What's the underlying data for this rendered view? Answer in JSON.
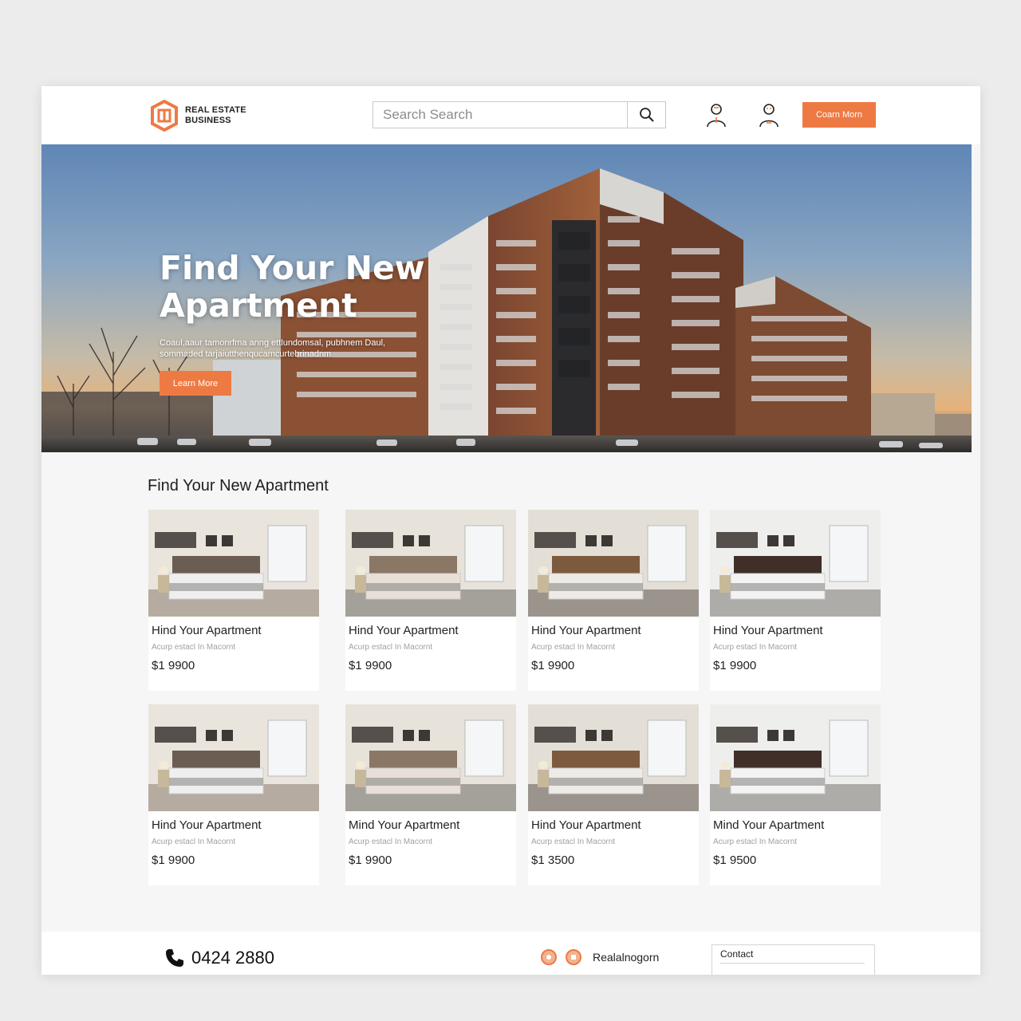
{
  "brand": {
    "line1": "REAL ESTATE",
    "line2": "BUSINESS",
    "accent": "#ee7a43"
  },
  "header": {
    "search_placeholder": "Search Search",
    "search_icon": "search-icon",
    "icons": [
      "user-account-icon",
      "user-profile-icon"
    ],
    "cta_label": "Coarn Morn"
  },
  "hero": {
    "title": "Find Your New Apartment",
    "description": "Coaul,aaur tamonrfma anng ettlundomsal, pubhnem Daul, sommaded tarjaiutthenqucamcurtebrinadnm",
    "button_label": "Learn More"
  },
  "listings": {
    "section_title": "Find Your New Apartment",
    "cards": [
      {
        "title": "Hind Your Apartment",
        "subtitle": "Acurp estacl In Macornt",
        "price": "$1 9900"
      },
      {
        "title": "Hind Your Apartment",
        "subtitle": "Acurp estacl In Macornt",
        "price": "$1 9900"
      },
      {
        "title": "Hind Your Apartment",
        "subtitle": "Acurp estacl In Macornt",
        "price": "$1 9900"
      },
      {
        "title": "Hind Your Apartment",
        "subtitle": "Acurp estacl In Macornt",
        "price": "$1 9900"
      },
      {
        "title": "Hind Your Apartment",
        "subtitle": "Acurp estacl In Macornt",
        "price": "$1 9900"
      },
      {
        "title": "Mind Your Apartment",
        "subtitle": "Acurp estacl In Macornt",
        "price": "$1 9900"
      },
      {
        "title": "Hind Your Apartment",
        "subtitle": "Acurp estacl In Macornt",
        "price": "$1 3500"
      },
      {
        "title": "Mind Your Apartment",
        "subtitle": "Acurp estacl In Macornt",
        "price": "$1 9500"
      }
    ]
  },
  "footer": {
    "phone": "0424 2880",
    "phone_icon": "phone-icon",
    "social_icons": [
      "social-icon-1",
      "social-icon-2"
    ],
    "website": "Realalnogorn",
    "contact_label": "Contact"
  }
}
